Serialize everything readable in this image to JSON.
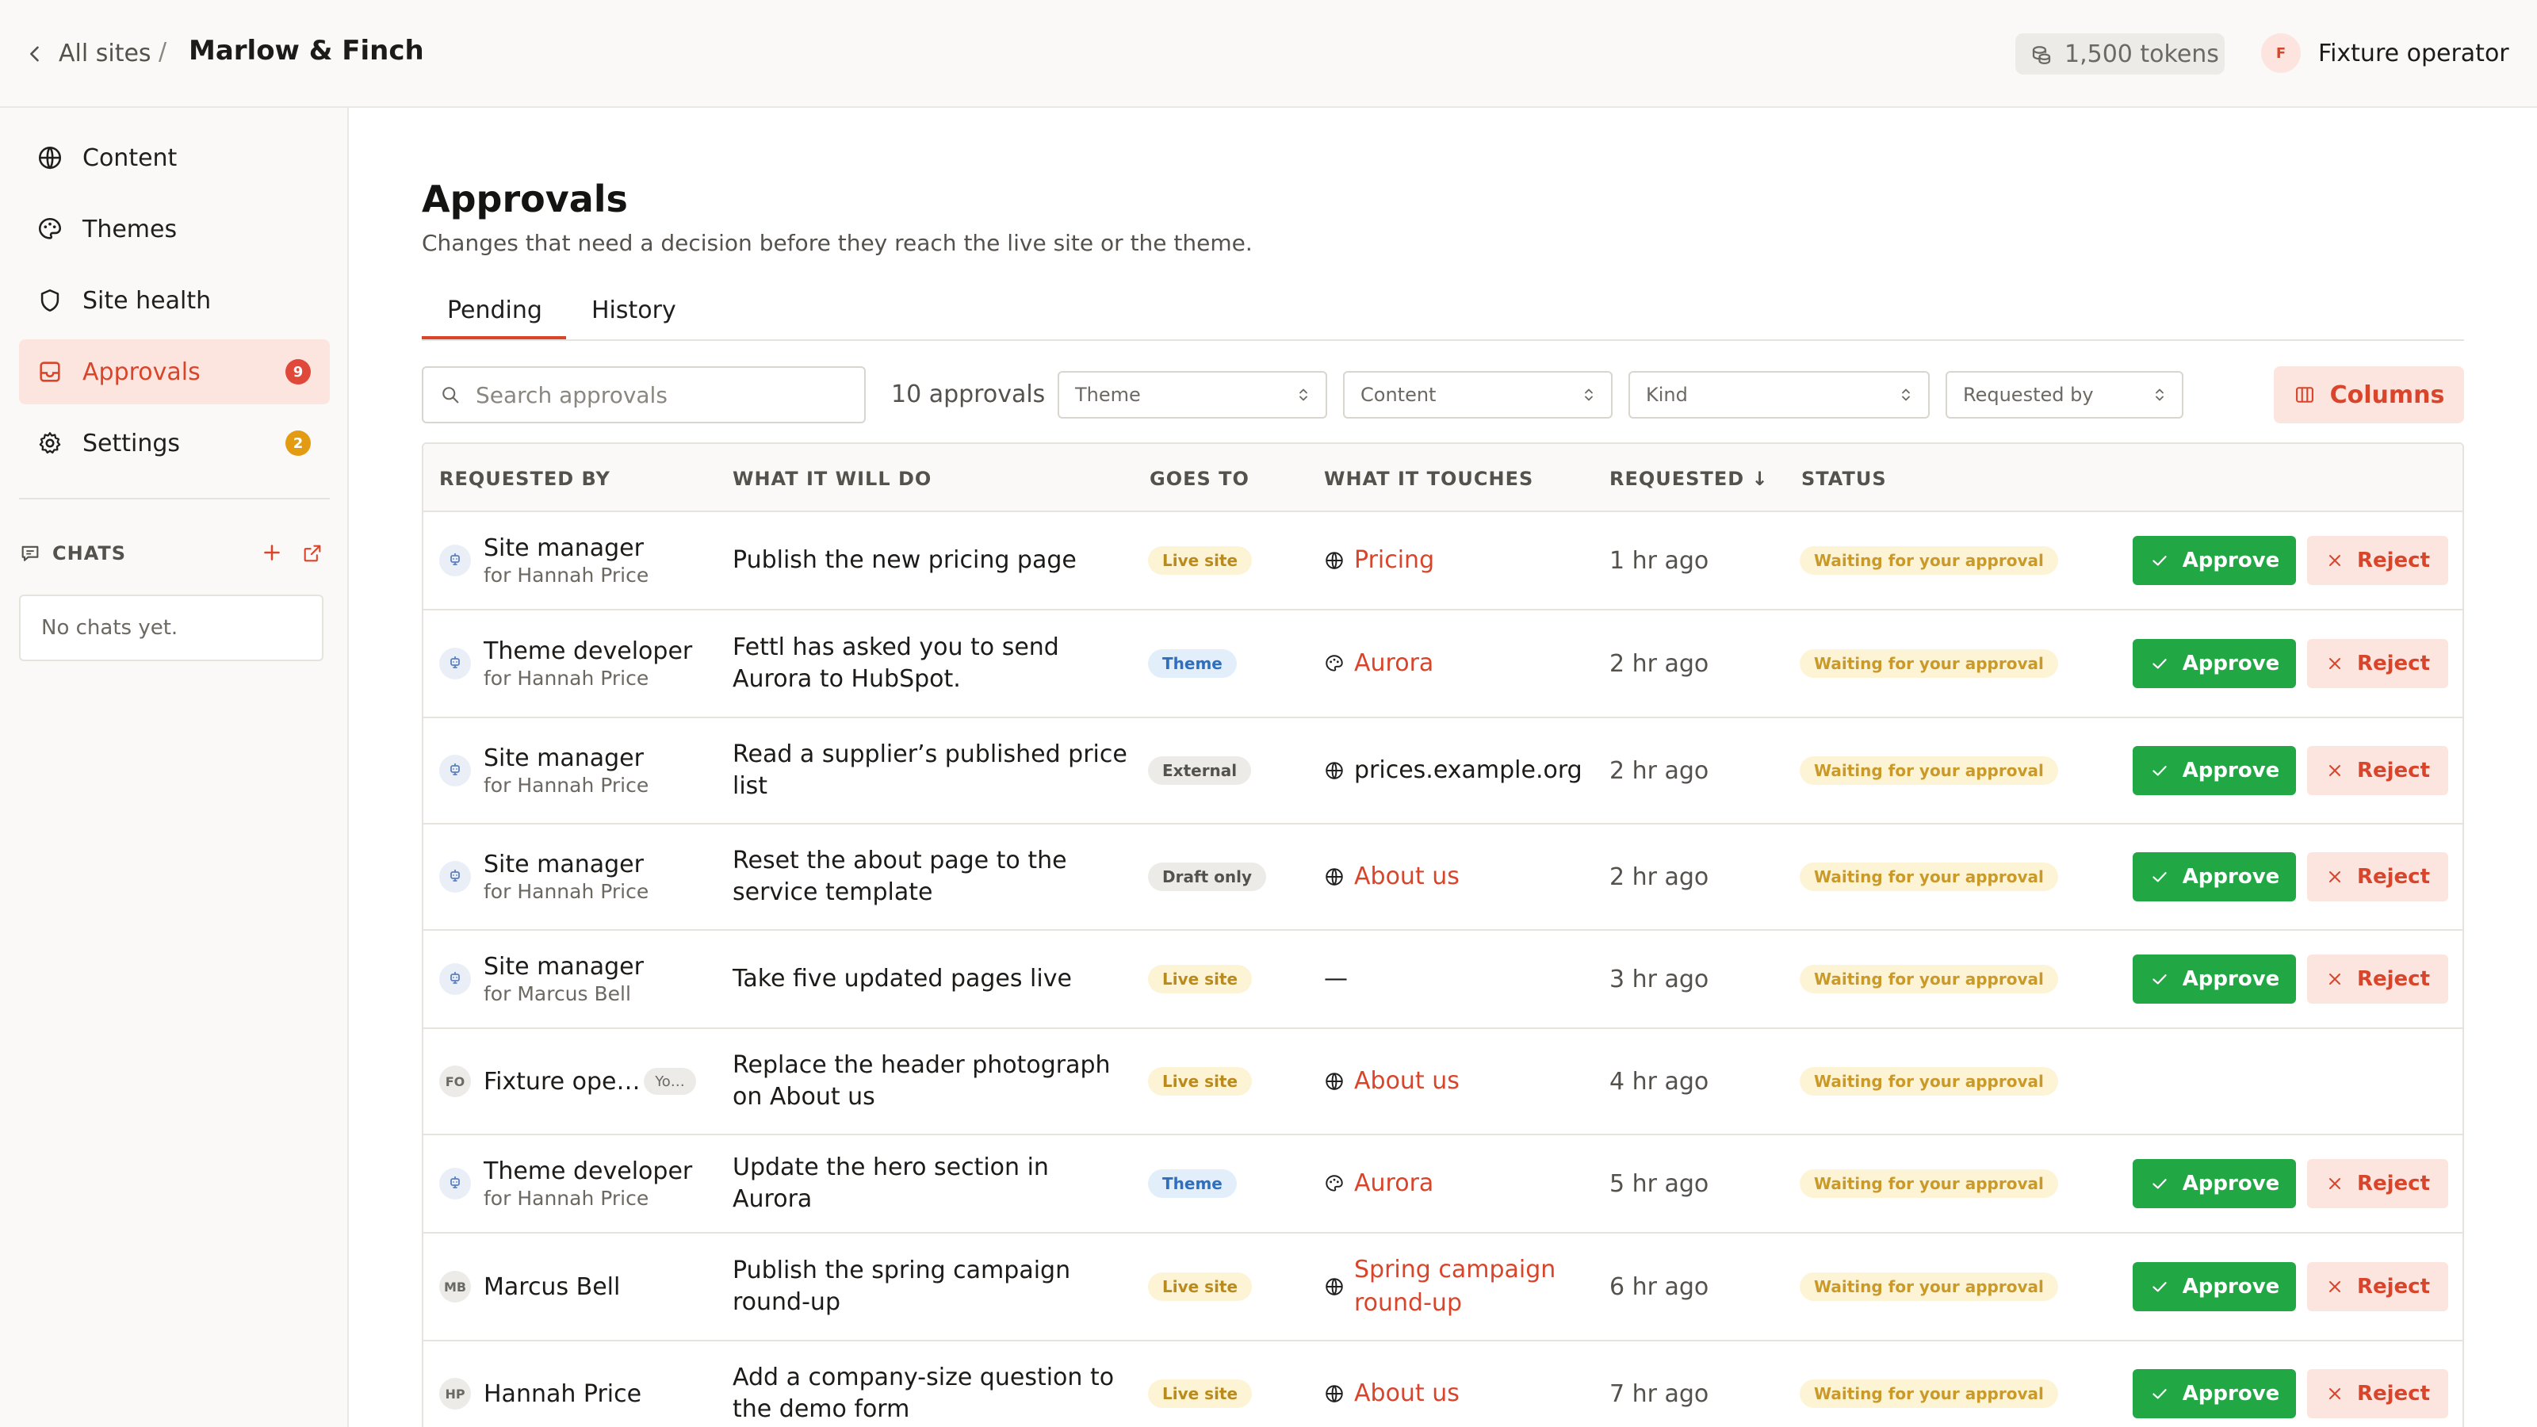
{
  "breadcrumb": {
    "back_label": "All sites",
    "separator": "/",
    "current": "Marlow & Finch"
  },
  "tokens": {
    "label": "1,500 tokens"
  },
  "user": {
    "initial": "F",
    "name": "Fixture operator"
  },
  "sidebar": {
    "items": [
      {
        "label": "Content",
        "icon": "globe-icon"
      },
      {
        "label": "Themes",
        "icon": "palette-icon"
      },
      {
        "label": "Site health",
        "icon": "shield-icon"
      },
      {
        "label": "Approvals",
        "icon": "inbox-icon",
        "badge": "9",
        "active": true
      },
      {
        "label": "Settings",
        "icon": "gear-icon",
        "badge": "2"
      }
    ],
    "chats": {
      "title": "CHATS",
      "empty": "No chats yet."
    }
  },
  "page": {
    "title": "Approvals",
    "subtitle": "Changes that need a decision before they reach the live site or the theme."
  },
  "tabs": [
    {
      "label": "Pending",
      "active": true
    },
    {
      "label": "History"
    }
  ],
  "toolbar": {
    "search_placeholder": "Search approvals",
    "count": "10 approvals",
    "filters": [
      "Theme",
      "Content",
      "Kind",
      "Requested by"
    ],
    "columns_label": "Columns"
  },
  "table": {
    "headers": [
      "REQUESTED BY",
      "WHAT IT WILL DO",
      "GOES TO",
      "WHAT IT TOUCHES",
      "REQUESTED ↓",
      "STATUS"
    ],
    "approve_label": "Approve",
    "reject_label": "Reject",
    "rows": [
      {
        "name": "Site manager",
        "for": "for Hannah Price",
        "what": "Publish the new pricing page",
        "goes": "Live site",
        "touch": "Pricing",
        "when": "1 hr ago",
        "status": "Waiting for your approval"
      },
      {
        "name": "Theme developer",
        "for": "for Hannah Price",
        "what": "Fettl has asked you to send Aurora to HubSpot.",
        "goes": "Theme",
        "touch": "Aurora",
        "when": "2 hr ago",
        "status": "Waiting for your approval"
      },
      {
        "name": "Site manager",
        "for": "for Hannah Price",
        "what": "Read a supplier’s published price list",
        "goes": "External",
        "touch": "prices.example.org",
        "when": "2 hr ago",
        "status": "Waiting for your approval"
      },
      {
        "name": "Site manager",
        "for": "for Hannah Price",
        "what": "Reset the about page to the service template",
        "goes": "Draft only",
        "touch": "About us",
        "when": "2 hr ago",
        "status": "Waiting for your approval"
      },
      {
        "name": "Site manager",
        "for": "for Marcus Bell",
        "what": "Take five updated pages live",
        "goes": "Live site",
        "touch": "—",
        "when": "3 hr ago",
        "status": "Waiting for your approval"
      },
      {
        "initials": "FO",
        "name": "Fixture ope…",
        "chip": "Yo…",
        "what": "Replace the header photograph on About us",
        "goes": "Live site",
        "touch": "About us",
        "when": "4 hr ago",
        "status": "Waiting for your approval"
      },
      {
        "name": "Theme developer",
        "for": "for Hannah Price",
        "what": "Update the hero section in Aurora",
        "goes": "Theme",
        "touch": "Aurora",
        "when": "5 hr ago",
        "status": "Waiting for your approval"
      },
      {
        "initials": "MB",
        "name": "Marcus Bell",
        "what": "Publish the spring campaign round-up",
        "goes": "Live site",
        "touch": "Spring campaign round-up",
        "when": "6 hr ago",
        "status": "Waiting for your approval"
      },
      {
        "initials": "HP",
        "name": "Hannah Price",
        "what": "Add a company-size question to the demo form",
        "goes": "Live site",
        "touch": "About us",
        "when": "7 hr ago",
        "status": "Waiting for your approval"
      }
    ]
  },
  "colors": {
    "accent": "#d9452b",
    "approve": "#22a745",
    "badge_red": "#e0483a",
    "badge_amber": "#e39b12"
  }
}
